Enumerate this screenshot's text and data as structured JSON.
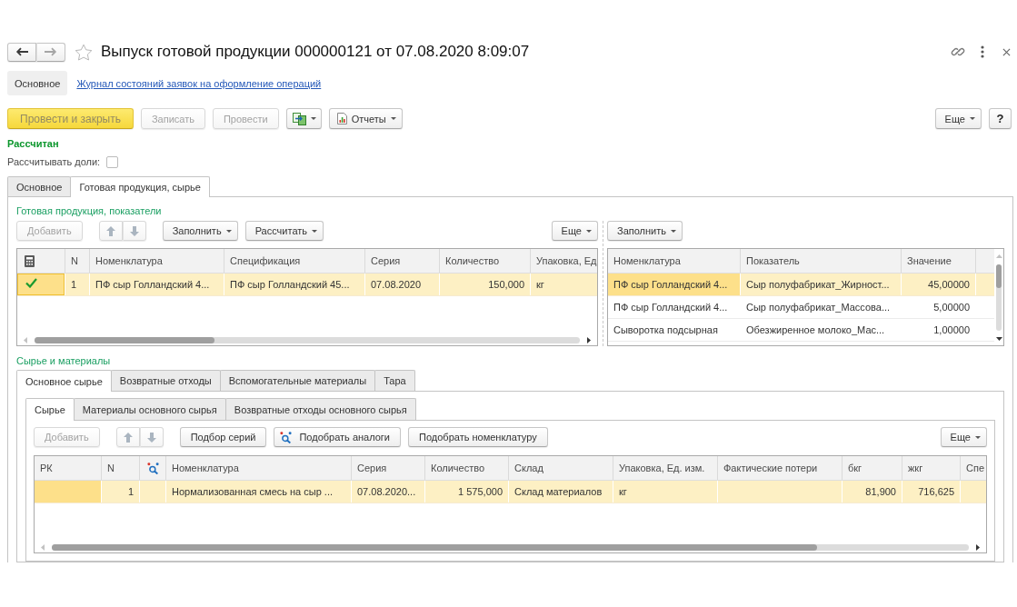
{
  "window": {
    "title": "Выпуск готовой продукции 000000121 от 07.08.2020 8:09:07",
    "favorite": false,
    "back": {
      "disabled": false
    },
    "forward": {
      "disabled": true
    }
  },
  "nav_panel": [
    {
      "label": "Основное",
      "selected": true
    },
    {
      "label": "Журнал состояний заявок на оформление операций",
      "selected": false
    }
  ],
  "command_bar": {
    "left": [
      {
        "kind": "primary",
        "label": "Провести и закрыть",
        "disabled": true
      },
      {
        "kind": "plain",
        "label": "Записать",
        "disabled": true
      },
      {
        "kind": "plain",
        "label": "Провести",
        "disabled": true
      },
      {
        "kind": "related",
        "disabled": false
      },
      {
        "kind": "reports",
        "label": "Отчеты",
        "disabled": false
      }
    ],
    "right": [
      {
        "kind": "menu",
        "label": "Еще",
        "disabled": false
      },
      {
        "kind": "help",
        "label": "?",
        "disabled": false
      }
    ]
  },
  "status": "Рассчитан",
  "calculate_shares": {
    "label": "Рассчитывать доли:",
    "checked": false
  },
  "tabs": [
    {
      "label": "Основное",
      "selected": false
    },
    {
      "label": "Готовая продукция, сырье",
      "selected": true
    }
  ],
  "products": {
    "title": "Готовая продукция, показатели",
    "toolbar": {
      "left": [
        {
          "kind": "plain",
          "label": "Добавить",
          "disabled": true
        },
        {
          "kind": "move",
          "disabled": true
        },
        {
          "kind": "menu",
          "label": "Заполнить",
          "disabled": false
        },
        {
          "kind": "menu",
          "label": "Рассчитать",
          "disabled": false
        }
      ],
      "right": [
        {
          "kind": "menu",
          "label": "Еще",
          "disabled": false
        }
      ]
    },
    "table": {
      "columns": [
        {
          "kind": "calc"
        },
        {
          "kind": "text",
          "label": "N"
        },
        {
          "kind": "text",
          "label": "Номенклатура"
        },
        {
          "kind": "text",
          "label": "Спецификация"
        },
        {
          "kind": "text",
          "label": "Серия"
        },
        {
          "kind": "number",
          "label": "Количество"
        },
        {
          "kind": "text",
          "label": "Упаковка, Ед"
        }
      ],
      "rows": [
        {
          "selected": true,
          "cells": [
            {
              "checked": true,
              "focused": true
            },
            {
              "text": "1",
              "focused": false
            },
            {
              "text": "ПФ сыр Голландский 4...",
              "focused": false
            },
            {
              "text": "ПФ сыр Голландский 45...",
              "focused": false
            },
            {
              "text": "07.08.2020",
              "focused": false
            },
            {
              "text": "150,000",
              "focused": false
            },
            {
              "text": "кг",
              "focused": false
            }
          ]
        }
      ]
    }
  },
  "indicators": {
    "toolbar": {
      "left": [
        {
          "kind": "menu",
          "label": "Заполнить",
          "disabled": false
        }
      ]
    },
    "table": {
      "columns": [
        {
          "kind": "text",
          "label": "Номенклатура"
        },
        {
          "kind": "text",
          "label": "Показатель"
        },
        {
          "kind": "number",
          "label": "Значение"
        },
        {
          "kind": "text"
        }
      ],
      "rows": [
        {
          "selected": true,
          "cells": [
            {
              "text": "ПФ сыр Голландский 4...",
              "focused": true
            },
            {
              "text": "Сыр полуфабрикат_Жирност...",
              "focused": false
            },
            {
              "text": "45,00000",
              "focused": false
            },
            {
              "focused": false
            }
          ]
        },
        {
          "selected": false,
          "cells": [
            {
              "text": "ПФ сыр Голландский 4...",
              "focused": false
            },
            {
              "text": "Сыр полуфабрикат_Массова...",
              "focused": false
            },
            {
              "text": "5,00000",
              "focused": false
            },
            {
              "focused": false
            }
          ]
        },
        {
          "selected": false,
          "cells": [
            {
              "text": "Сыворотка подсырная",
              "focused": false
            },
            {
              "text": "Обезжиренное молоко_Мас...",
              "focused": false
            },
            {
              "text": "1,00000",
              "focused": false
            },
            {
              "focused": false
            }
          ]
        }
      ]
    }
  },
  "materials": {
    "title": "Сырье и материалы",
    "tabs": [
      {
        "label": "Основное сырье",
        "selected": true
      },
      {
        "label": "Возвратные отходы",
        "selected": false
      },
      {
        "label": "Вспомогательные материалы",
        "selected": false
      },
      {
        "label": "Тара",
        "selected": false
      }
    ],
    "subtabs": [
      {
        "label": "Сырье",
        "selected": true
      },
      {
        "label": "Материалы основного сырья",
        "selected": false
      },
      {
        "label": "Возвратные отходы основного сырья",
        "selected": false
      }
    ],
    "toolbar": {
      "left": [
        {
          "kind": "plain",
          "label": "Добавить",
          "disabled": true
        },
        {
          "kind": "move",
          "disabled": true
        },
        {
          "kind": "plain",
          "label": "Подбор серий",
          "disabled": false
        },
        {
          "kind": "analogs",
          "label": "Подобрать аналоги",
          "disabled": false
        },
        {
          "kind": "plain",
          "label": "Подобрать номенклатуру",
          "disabled": false
        }
      ],
      "right": [
        {
          "kind": "menu",
          "label": "Еще",
          "disabled": false
        }
      ]
    },
    "table": {
      "columns": [
        {
          "kind": "text",
          "label": "РК"
        },
        {
          "kind": "number",
          "label": "N"
        },
        {
          "kind": "analogs"
        },
        {
          "kind": "text",
          "label": "Номенклатура"
        },
        {
          "kind": "text",
          "label": "Серия"
        },
        {
          "kind": "number",
          "label": "Количество"
        },
        {
          "kind": "text",
          "label": "Склад"
        },
        {
          "kind": "text",
          "label": "Упаковка, Ед. изм."
        },
        {
          "kind": "text",
          "label": "Фактические потери"
        },
        {
          "kind": "number",
          "label": "бкг"
        },
        {
          "kind": "number",
          "label": "жкг"
        },
        {
          "kind": "text",
          "label": "Спе"
        }
      ],
      "rows": [
        {
          "selected": true,
          "cells": [
            {
              "focused": true
            },
            {
              "text": "1",
              "focused": false
            },
            {
              "focused": false
            },
            {
              "text": "Нормализованная смесь на сыр ...",
              "focused": false
            },
            {
              "text": "07.08.2020...",
              "focused": false
            },
            {
              "text": "1 575,000",
              "focused": false
            },
            {
              "text": "Склад материалов",
              "focused": false
            },
            {
              "text": "кг",
              "focused": false
            },
            {
              "focused": false
            },
            {
              "text": "81,900",
              "focused": false
            },
            {
              "text": "716,625",
              "focused": false
            },
            {
              "focused": false
            }
          ]
        }
      ]
    }
  }
}
